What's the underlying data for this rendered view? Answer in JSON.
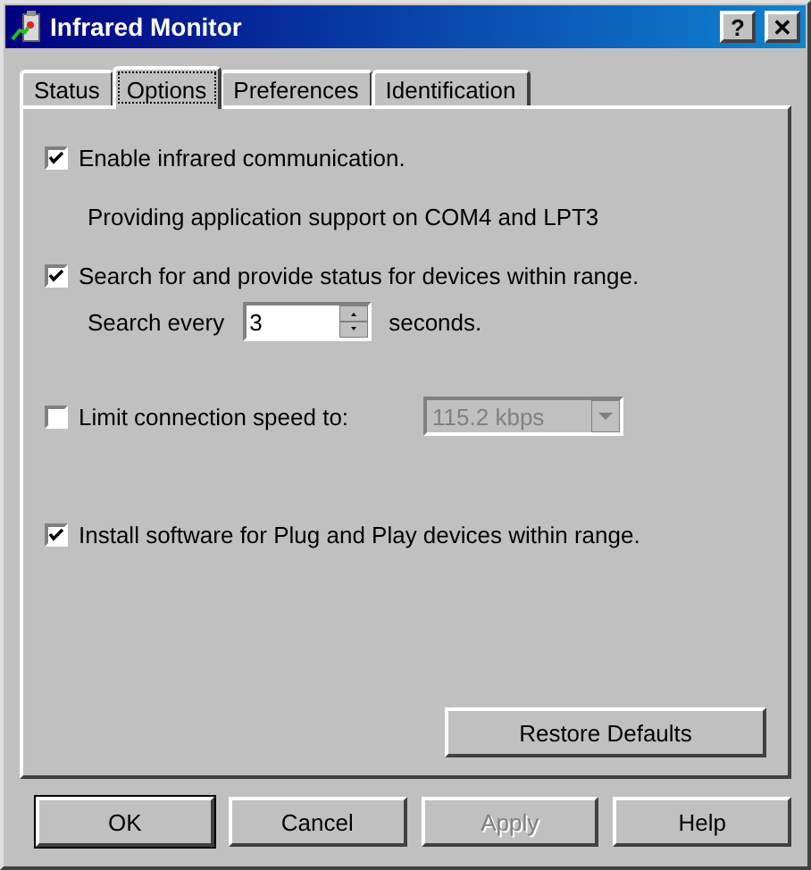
{
  "window": {
    "title": "Infrared Monitor",
    "help_label": "?",
    "close_label": "✕"
  },
  "tabs": [
    {
      "label": "Status",
      "selected": false
    },
    {
      "label": "Options",
      "selected": true
    },
    {
      "label": "Preferences",
      "selected": false
    },
    {
      "label": "Identification",
      "selected": false
    }
  ],
  "options": [
    {
      "kind": "checkbox",
      "label": "Enable infrared communication.",
      "checked": true
    },
    {
      "kind": "text",
      "label": "Providing application support on COM4 and LPT3"
    },
    {
      "kind": "checkbox",
      "label": "Search for and provide status for devices within range.",
      "checked": true
    },
    {
      "kind": "interval",
      "label": "Search every",
      "value": "3",
      "unit": "seconds."
    },
    {
      "kind": "speed",
      "label": "Limit connection speed to:",
      "checked": false,
      "value": "115.2 kbps",
      "disabled": true
    },
    {
      "kind": "checkbox",
      "label": "Install software for Plug and Play devices within range.",
      "checked": true
    }
  ],
  "restore_button": "Restore Defaults",
  "buttons": [
    {
      "label": "OK",
      "disabled": false,
      "default": true
    },
    {
      "label": "Cancel",
      "disabled": false,
      "default": false
    },
    {
      "label": "Apply",
      "disabled": true,
      "default": false
    },
    {
      "label": "Help",
      "disabled": false,
      "default": false
    }
  ]
}
